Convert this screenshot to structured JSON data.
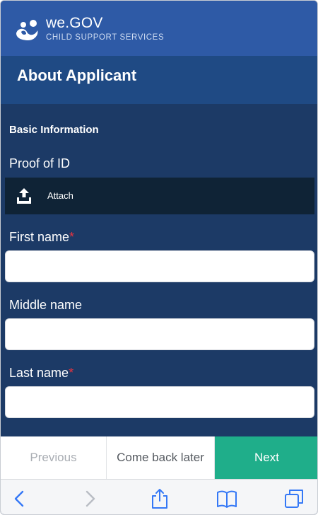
{
  "brand": {
    "name": "we.GOV",
    "subtitle": "CHILD SUPPORT SERVICES"
  },
  "page": {
    "title": "About Applicant"
  },
  "form": {
    "section_title": "Basic Information",
    "proof_of_id": {
      "label": "Proof of ID",
      "attach_label": "Attach"
    },
    "fields": [
      {
        "label": "First name",
        "required": "*",
        "value": ""
      },
      {
        "label": "Middle name",
        "value": ""
      },
      {
        "label": "Last name",
        "required": "*",
        "value": ""
      }
    ]
  },
  "actions": {
    "previous": "Previous",
    "come_back_later": "Come back later",
    "next": "Next"
  },
  "colors": {
    "brand_blue": "#2e5aa6",
    "title_band": "#1f4a84",
    "form_bg": "#1c3a66",
    "attach_bg": "#0f2336",
    "required_red": "#e5343f",
    "next_green": "#1fae8a",
    "toolbar_tint": "#3478f6"
  },
  "toolbar": {
    "icons": [
      "back-icon",
      "forward-icon",
      "share-icon",
      "bookmarks-icon",
      "tabs-icon"
    ]
  }
}
